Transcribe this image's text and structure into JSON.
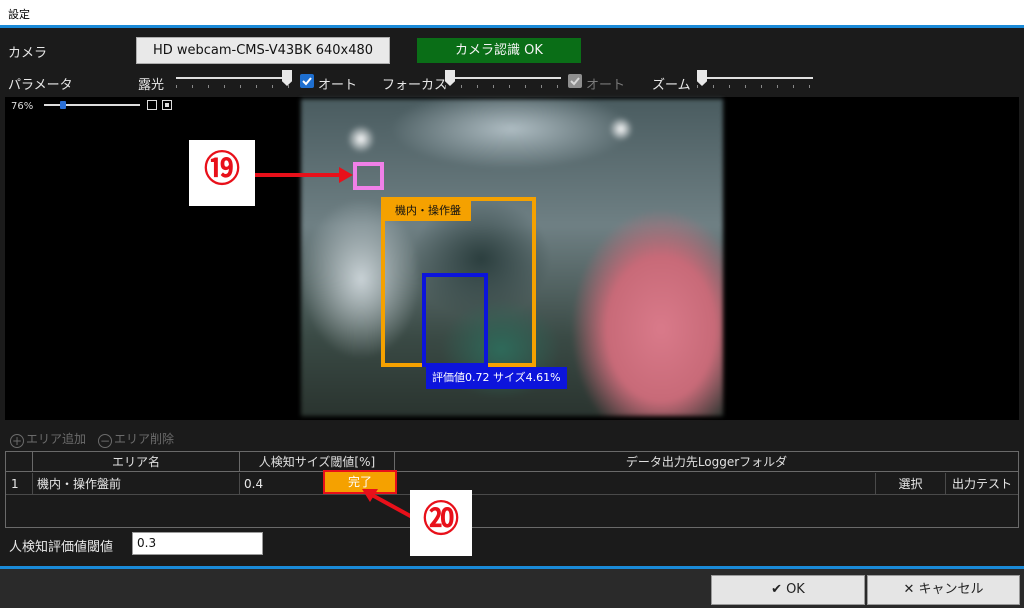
{
  "window": {
    "title": "設定"
  },
  "camera": {
    "label": "カメラ",
    "device_button": "HD webcam-CMS-V43BK  640x480",
    "status": "カメラ認識 OK",
    "status_color": "#0a6e17"
  },
  "parameters": {
    "label": "パラメータ",
    "exposure_label": "露光",
    "exposure_level": 1.0,
    "exposure_auto_label": "オート",
    "exposure_auto": true,
    "focus_label": "フォーカス",
    "focus_level": 0.0,
    "focus_auto_label": "オート",
    "focus_auto": true,
    "zoom_label": "ズーム",
    "zoom_level": 0.0
  },
  "viewer": {
    "zoom_percent": "76%",
    "area_label": "機内・操作盤",
    "detection_label": "評価値0.72  サイズ4.61%",
    "area_color": "#f5a100",
    "detection_color": "#0c14dc",
    "marker_color": "#f080e8"
  },
  "callouts": {
    "c19": "⑲",
    "c20": "⑳",
    "color": "#e8101a"
  },
  "area_tools": {
    "add": "エリア追加",
    "delete": "エリア削除"
  },
  "table": {
    "headers": {
      "name": "エリア名",
      "size_threshold": "人検知サイズ閾値[%]",
      "output": "データ出力先Loggerフォルダ"
    },
    "rows": [
      {
        "index": "1",
        "name": "機内・操作盤前",
        "threshold": "0.4",
        "done": "完了",
        "select": "選択",
        "test": "出力テスト"
      }
    ]
  },
  "eval_threshold": {
    "label": "人検知評価値閾値",
    "value": "0.3"
  },
  "footer": {
    "ok": "OK",
    "cancel": "キャンセル"
  }
}
